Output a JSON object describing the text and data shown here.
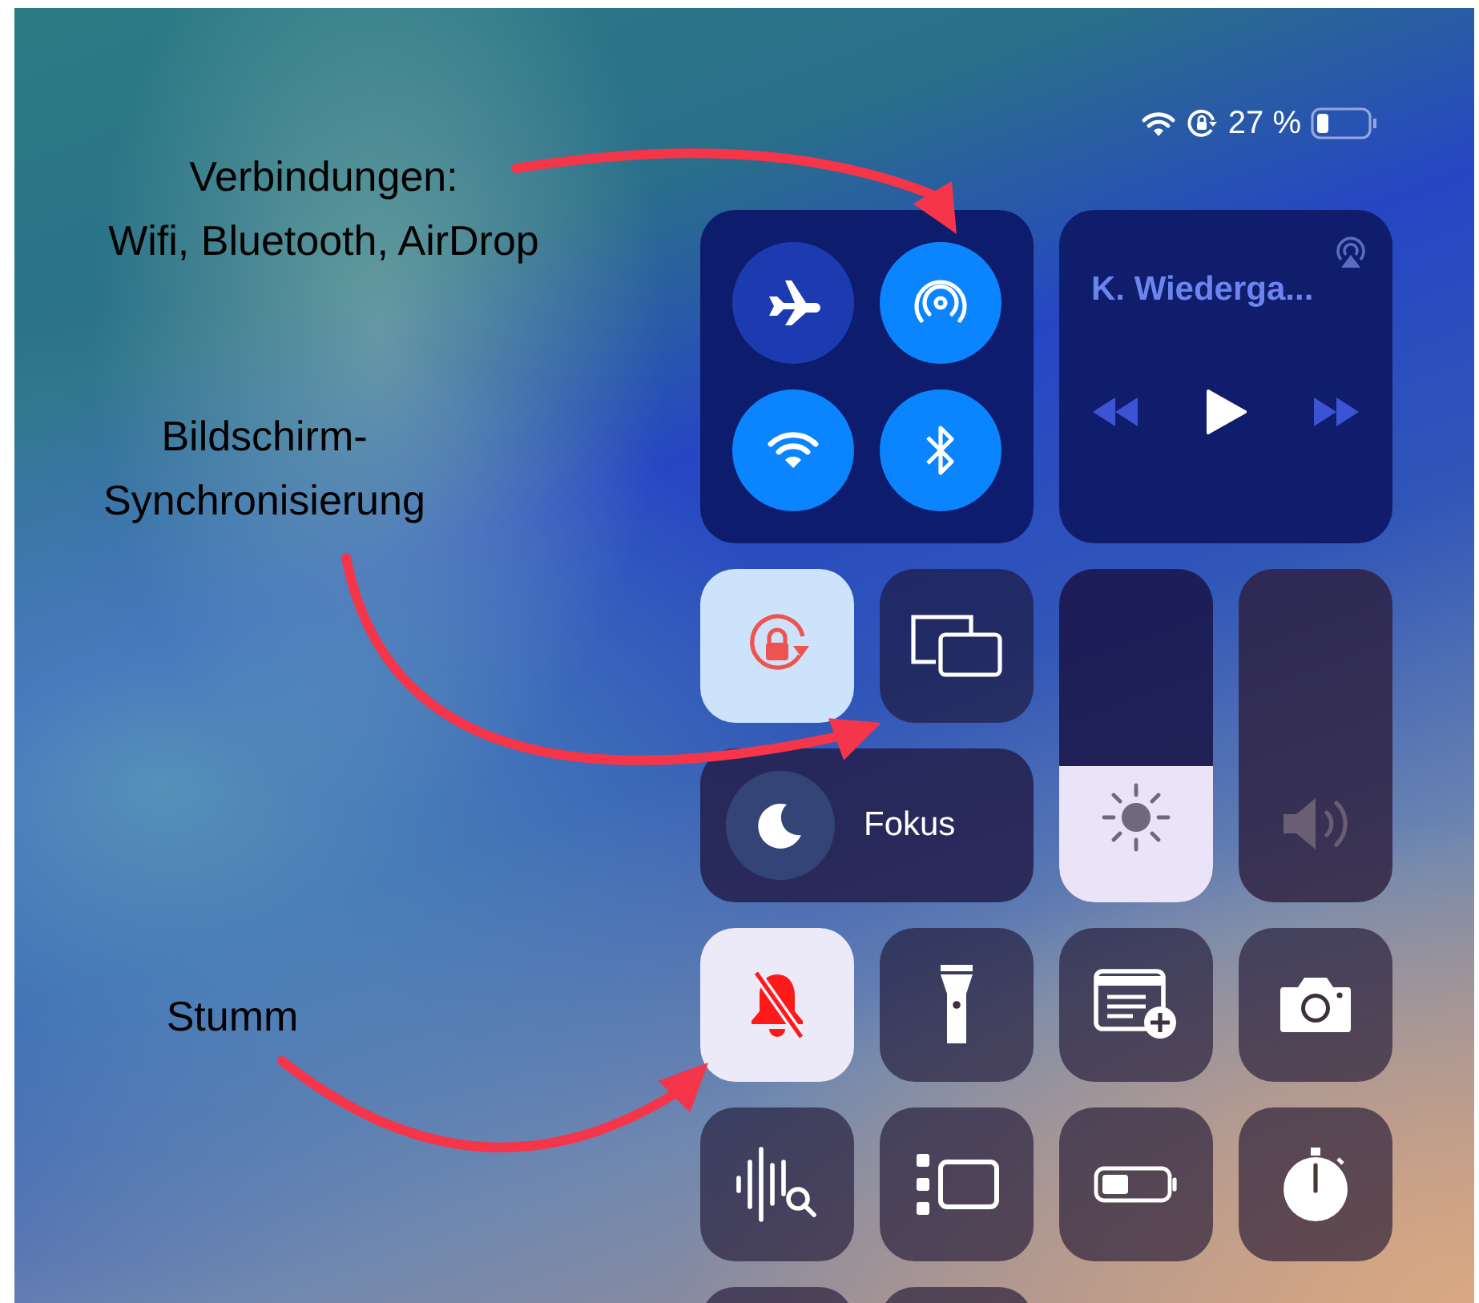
{
  "status_bar": {
    "battery_text": "27 %"
  },
  "connectivity": [
    {
      "kind": "airplane",
      "on": false
    },
    {
      "kind": "airdrop",
      "on": true
    },
    {
      "kind": "wifi",
      "on": true
    },
    {
      "kind": "bluetooth",
      "on": true
    }
  ],
  "now_playing": {
    "title": "K. Wiederga..."
  },
  "tiles": [
    {
      "kind": "rotation_lock",
      "on": true
    },
    {
      "kind": "screen_mirroring",
      "on": false
    },
    {
      "kind": "brightness",
      "level": 0.41
    },
    {
      "kind": "volume",
      "level": 0
    },
    {
      "kind": "focus",
      "label": "Fokus"
    },
    {
      "kind": "silent",
      "on": true
    },
    {
      "kind": "flashlight",
      "on": false
    },
    {
      "kind": "quick_note",
      "on": false
    },
    {
      "kind": "camera",
      "on": false
    },
    {
      "kind": "sound_recognition",
      "on": false
    },
    {
      "kind": "stage_manager",
      "on": false
    },
    {
      "kind": "low_power",
      "on": false
    },
    {
      "kind": "stopwatch",
      "on": false
    },
    {
      "kind": "blank"
    },
    {
      "kind": "blank"
    }
  ],
  "annotations": [
    {
      "text": "Verbindungen:\nWifi, Bluetooth, AirDrop"
    },
    {
      "text": "Bildschirm-\nSynchronisierung"
    },
    {
      "text": "Stumm"
    }
  ]
}
